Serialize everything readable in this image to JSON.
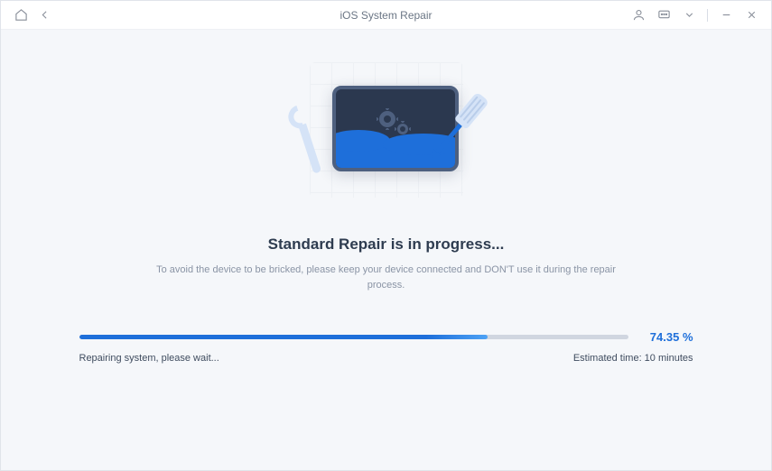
{
  "titlebar": {
    "title": "iOS System Repair"
  },
  "illustration": {
    "device_icon": "device-screen-icon",
    "wrench_icon": "wrench-icon",
    "screwdriver_icon": "screwdriver-icon",
    "gear_icon": "gear-icon"
  },
  "content": {
    "heading": "Standard Repair is in progress...",
    "subtext": "To avoid the device to be bricked, please keep your device connected and DON'T use it during the repair process."
  },
  "progress": {
    "percent_value": 74.35,
    "percent_label": "74.35 %",
    "status_text": "Repairing system, please wait...",
    "eta_text": "Estimated time: 10 minutes"
  }
}
